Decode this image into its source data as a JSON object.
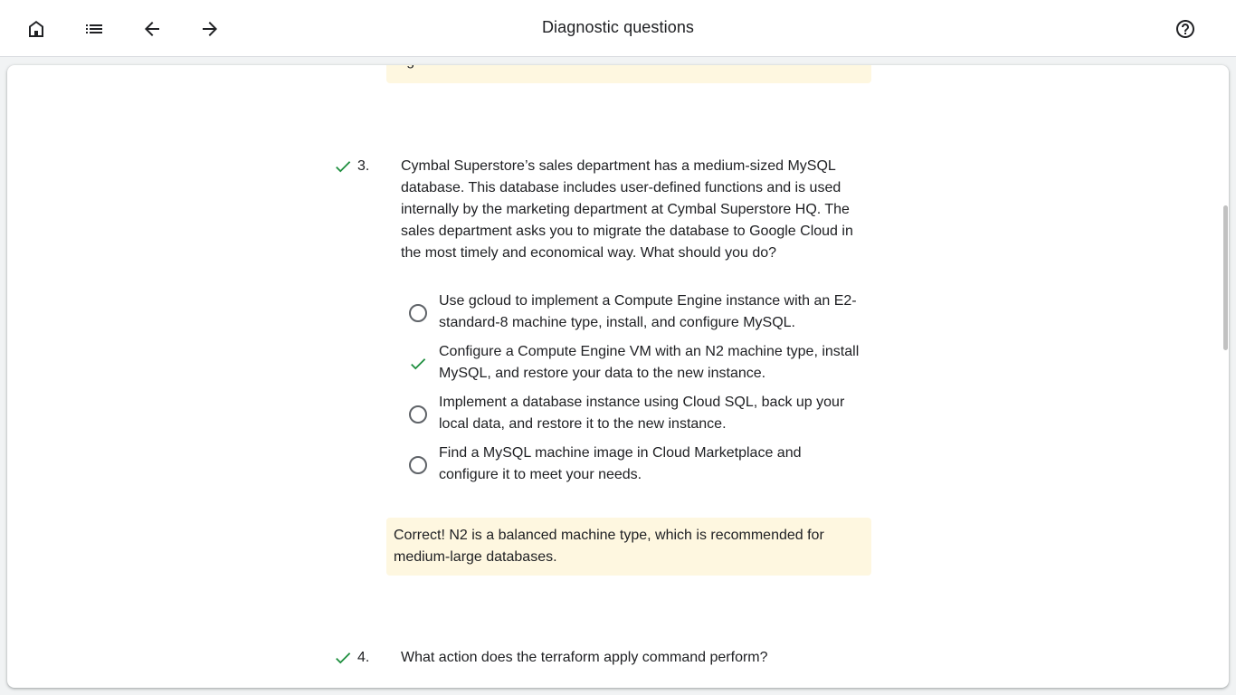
{
  "header": {
    "title": "Diagnostic questions",
    "icons": {
      "home": "home-icon",
      "list": "list-icon",
      "back": "arrow-back-icon",
      "forward": "arrow-forward-icon",
      "help": "help-icon"
    }
  },
  "previous_feedback": {
    "text": "region."
  },
  "questions": [
    {
      "number": "3.",
      "status": "correct",
      "text": "Cymbal Superstore’s sales department has a medium-sized MySQL database. This database includes user-defined functions and is used internally by the marketing department at Cymbal Superstore HQ. The sales department asks you to migrate the database to Google Cloud in the most timely and economical way. What should you do?",
      "options": [
        {
          "label": "Use gcloud to implement a Compute Engine instance with an E2-standard-8 machine type, install, and configure MySQL.",
          "selected": false
        },
        {
          "label": "Configure a Compute Engine VM with an N2 machine type, install MySQL, and restore your data to the new instance.",
          "selected": true
        },
        {
          "label": "Implement a database instance using Cloud SQL, back up your local data, and restore it to the new instance.",
          "selected": false
        },
        {
          "label": "Find a MySQL machine image in Cloud Marketplace and configure it to meet your needs.",
          "selected": false
        }
      ],
      "feedback": "Correct! N2 is a balanced machine type, which is recommended for medium-large databases."
    },
    {
      "number": "4.",
      "status": "correct",
      "text": "What action does the terraform apply command perform?"
    }
  ],
  "colors": {
    "correct": "#1e8e3e",
    "feedback_bg": "#fef7e0"
  }
}
